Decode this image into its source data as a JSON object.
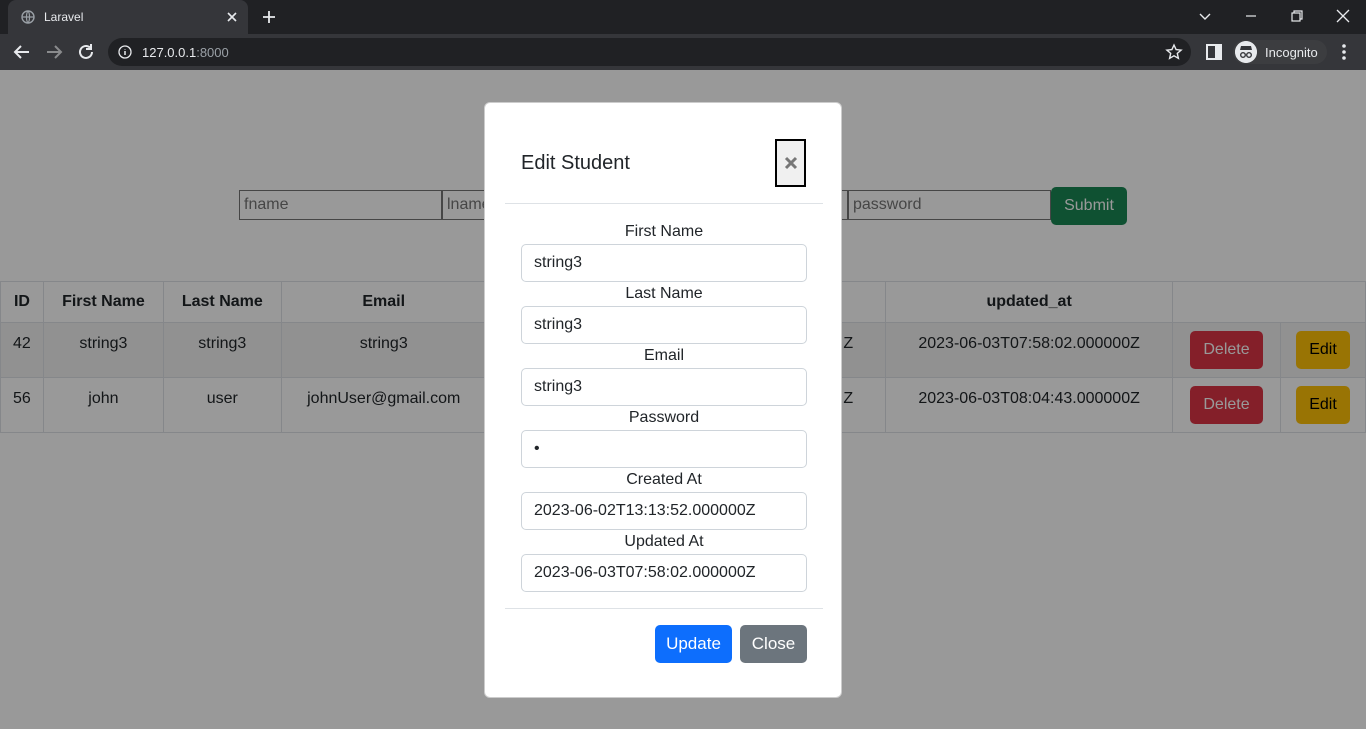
{
  "browser": {
    "tab_title": "Laravel",
    "url_host": "127.0.0.1",
    "url_port": ":8000",
    "profile_label": "Incognito"
  },
  "form": {
    "placeholders": [
      "fname",
      "lname",
      "",
      "",
      "password"
    ],
    "submit_label": "Submit"
  },
  "table": {
    "headers": [
      "ID",
      "First Name",
      "Last Name",
      "Email",
      "",
      "updated_at",
      ""
    ],
    "rows": [
      {
        "id": "42",
        "first": "string3",
        "last": "string3",
        "email": "string3",
        "created_tail": "Z",
        "updated": "2023-06-03T07:58:02.000000Z"
      },
      {
        "id": "56",
        "first": "john",
        "last": "user",
        "email": "johnUser@gmail.com",
        "created_tail": "Z",
        "updated": "2023-06-03T08:04:43.000000Z"
      }
    ],
    "delete_label": "Delete",
    "edit_label": "Edit"
  },
  "modal": {
    "title": "Edit Student",
    "fields": [
      {
        "label": "First Name",
        "value": "string3"
      },
      {
        "label": "Last Name",
        "value": "string3"
      },
      {
        "label": "Email",
        "value": "string3"
      },
      {
        "label": "Password",
        "value": "•"
      },
      {
        "label": "Created At",
        "value": "2023-06-02T13:13:52.000000Z"
      },
      {
        "label": "Updated At",
        "value": "2023-06-03T07:58:02.000000Z"
      }
    ],
    "update_label": "Update",
    "close_label": "Close"
  }
}
